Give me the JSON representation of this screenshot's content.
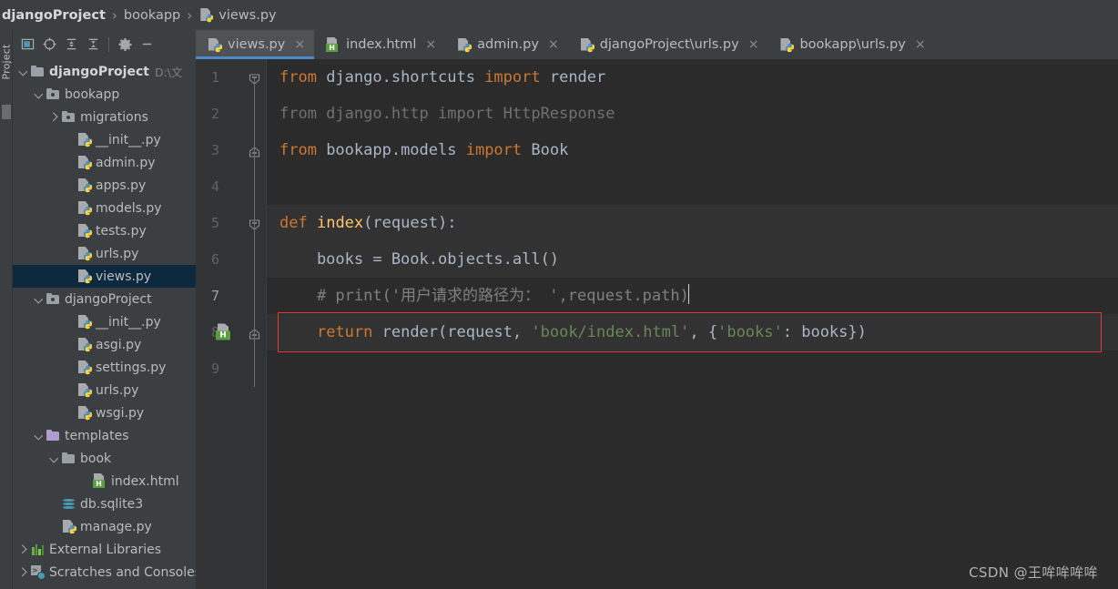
{
  "breadcrumb": {
    "items": [
      {
        "label": "djangoProject",
        "bold": true,
        "icon": ""
      },
      {
        "label": "bookapp",
        "bold": false,
        "icon": ""
      },
      {
        "label": "views.py",
        "bold": false,
        "icon": "python-file-icon"
      }
    ],
    "separator": "›"
  },
  "left_strip": {
    "label": "Project"
  },
  "panel_toolbar": {
    "buttons": [
      {
        "name": "select-opened-file-icon",
        "title": "Select Opened File"
      },
      {
        "name": "locate-target-icon",
        "title": "Scroll from Source"
      },
      {
        "name": "expand-all-icon",
        "title": "Expand All"
      },
      {
        "name": "collapse-all-icon",
        "title": "Collapse All"
      },
      {
        "name": "settings-gear-icon",
        "title": "Settings"
      },
      {
        "name": "hide-panel-icon",
        "title": "Hide"
      }
    ]
  },
  "tree": {
    "rows": [
      {
        "indent": 0,
        "arrow": "down",
        "icon": "folder",
        "label": "djangoProject",
        "bold": true,
        "path": "D:\\文",
        "selected": false
      },
      {
        "indent": 1,
        "arrow": "down",
        "icon": "folder-src",
        "label": "bookapp",
        "bold": false,
        "path": "",
        "selected": false
      },
      {
        "indent": 2,
        "arrow": "right",
        "icon": "folder-src",
        "label": "migrations",
        "bold": false,
        "path": "",
        "selected": false
      },
      {
        "indent": 3,
        "arrow": "none",
        "icon": "py",
        "label": "__init__.py",
        "bold": false,
        "path": "",
        "selected": false
      },
      {
        "indent": 3,
        "arrow": "none",
        "icon": "py",
        "label": "admin.py",
        "bold": false,
        "path": "",
        "selected": false
      },
      {
        "indent": 3,
        "arrow": "none",
        "icon": "py",
        "label": "apps.py",
        "bold": false,
        "path": "",
        "selected": false
      },
      {
        "indent": 3,
        "arrow": "none",
        "icon": "py",
        "label": "models.py",
        "bold": false,
        "path": "",
        "selected": false
      },
      {
        "indent": 3,
        "arrow": "none",
        "icon": "py",
        "label": "tests.py",
        "bold": false,
        "path": "",
        "selected": false
      },
      {
        "indent": 3,
        "arrow": "none",
        "icon": "py",
        "label": "urls.py",
        "bold": false,
        "path": "",
        "selected": false
      },
      {
        "indent": 3,
        "arrow": "none",
        "icon": "py",
        "label": "views.py",
        "bold": false,
        "path": "",
        "selected": true
      },
      {
        "indent": 1,
        "arrow": "down",
        "icon": "folder-src",
        "label": "djangoProject",
        "bold": false,
        "path": "",
        "selected": false
      },
      {
        "indent": 3,
        "arrow": "none",
        "icon": "py",
        "label": "__init__.py",
        "bold": false,
        "path": "",
        "selected": false
      },
      {
        "indent": 3,
        "arrow": "none",
        "icon": "py",
        "label": "asgi.py",
        "bold": false,
        "path": "",
        "selected": false
      },
      {
        "indent": 3,
        "arrow": "none",
        "icon": "py",
        "label": "settings.py",
        "bold": false,
        "path": "",
        "selected": false
      },
      {
        "indent": 3,
        "arrow": "none",
        "icon": "py",
        "label": "urls.py",
        "bold": false,
        "path": "",
        "selected": false
      },
      {
        "indent": 3,
        "arrow": "none",
        "icon": "py",
        "label": "wsgi.py",
        "bold": false,
        "path": "",
        "selected": false
      },
      {
        "indent": 1,
        "arrow": "down",
        "icon": "folder-tpl",
        "label": "templates",
        "bold": false,
        "path": "",
        "selected": false
      },
      {
        "indent": 2,
        "arrow": "down",
        "icon": "folder",
        "label": "book",
        "bold": false,
        "path": "",
        "selected": false
      },
      {
        "indent": 4,
        "arrow": "none",
        "icon": "html",
        "label": "index.html",
        "bold": false,
        "path": "",
        "selected": false
      },
      {
        "indent": 2,
        "arrow": "none",
        "icon": "db",
        "label": "db.sqlite3",
        "bold": false,
        "path": "",
        "selected": false
      },
      {
        "indent": 2,
        "arrow": "none",
        "icon": "py",
        "label": "manage.py",
        "bold": false,
        "path": "",
        "selected": false
      },
      {
        "indent": 0,
        "arrow": "right",
        "icon": "lib",
        "label": "External Libraries",
        "bold": false,
        "path": "",
        "selected": false
      },
      {
        "indent": 0,
        "arrow": "right",
        "icon": "scratch",
        "label": "Scratches and Consoles",
        "bold": false,
        "path": "",
        "selected": false
      }
    ]
  },
  "tabs": {
    "close_glyph": "×",
    "items": [
      {
        "label": "views.py",
        "icon": "python-file-icon",
        "active": true
      },
      {
        "label": "index.html",
        "icon": "html-file-icon",
        "active": false
      },
      {
        "label": "admin.py",
        "icon": "python-file-icon",
        "active": false
      },
      {
        "label": "djangoProject\\urls.py",
        "icon": "python-file-icon",
        "active": false
      },
      {
        "label": "bookapp\\urls.py",
        "icon": "python-file-icon",
        "active": false
      }
    ]
  },
  "editor": {
    "file": "views.py",
    "line_numbers": [
      "1",
      "2",
      "3",
      "4",
      "5",
      "6",
      "7",
      "8",
      "9"
    ],
    "current_line": 7,
    "highlighted_lines": [
      5,
      6,
      8
    ],
    "error_line": 8,
    "error_border_color": "#e53935",
    "lines": [
      {
        "no": 1,
        "tokens": [
          {
            "t": "from",
            "c": "k"
          },
          {
            "t": " django.shortcuts ",
            "c": "id"
          },
          {
            "t": "import",
            "c": "k"
          },
          {
            "t": " render",
            "c": "id"
          }
        ]
      },
      {
        "no": 2,
        "tokens": [
          {
            "t": "from django.http import HttpResponse",
            "c": "dim"
          }
        ]
      },
      {
        "no": 3,
        "tokens": [
          {
            "t": "from",
            "c": "k"
          },
          {
            "t": " bookapp.models ",
            "c": "id"
          },
          {
            "t": "import",
            "c": "k"
          },
          {
            "t": " Book",
            "c": "id"
          }
        ]
      },
      {
        "no": 4,
        "tokens": []
      },
      {
        "no": 5,
        "tokens": [
          {
            "t": "def",
            "c": "k"
          },
          {
            "t": " ",
            "c": "id"
          },
          {
            "t": "index",
            "c": "fn"
          },
          {
            "t": "(request):",
            "c": "id"
          }
        ]
      },
      {
        "no": 6,
        "tokens": [
          {
            "t": "    books = Book.objects.all()",
            "c": "id"
          }
        ]
      },
      {
        "no": 7,
        "tokens": [
          {
            "t": "    # print('用户请求的路径为： ',request.path)",
            "c": "cmt"
          }
        ]
      },
      {
        "no": 8,
        "tokens": [
          {
            "t": "    ",
            "c": "id"
          },
          {
            "t": "return",
            "c": "k"
          },
          {
            "t": " render(request, ",
            "c": "id"
          },
          {
            "t": "'book/index.html'",
            "c": "str"
          },
          {
            "t": ", {",
            "c": "id"
          },
          {
            "t": "'books'",
            "c": "str"
          },
          {
            "t": ": books})",
            "c": "id"
          }
        ]
      },
      {
        "no": 9,
        "tokens": []
      }
    ],
    "gutter_icons": [
      {
        "line": 8,
        "name": "html-template-gutter-icon",
        "badge": "H"
      }
    ],
    "fold_markers": [
      {
        "line": 1,
        "type": "fold-start"
      },
      {
        "line": 3,
        "type": "fold-end"
      },
      {
        "line": 5,
        "type": "fold-start"
      },
      {
        "line": 8,
        "type": "fold-end"
      }
    ]
  },
  "watermark": {
    "text": "CSDN @王哞哞哞哞"
  },
  "colors": {
    "bg_panel": "#3c3f41",
    "bg_editor": "#2b2b2b",
    "bg_gutter": "#313335",
    "tab_active": "#4e5254",
    "tab_underline": "#4a88c7",
    "tree_selection": "#0d293e",
    "keyword": "#cc7832",
    "string": "#6a8759",
    "comment": "#808080",
    "identifier": "#a9b7c6",
    "function": "#ffc66d",
    "error": "#e53935",
    "line_highlight": "#323232"
  }
}
